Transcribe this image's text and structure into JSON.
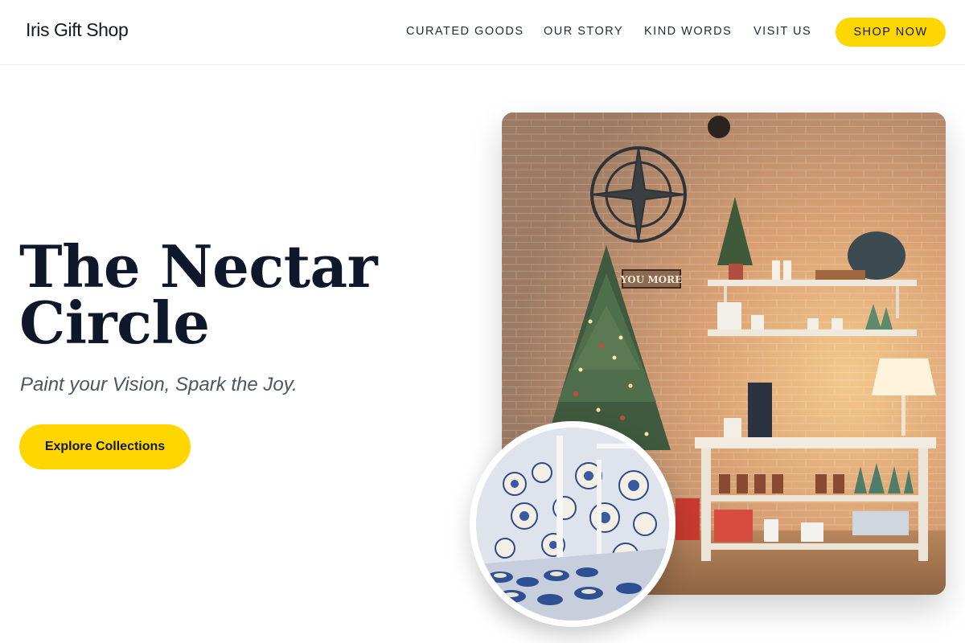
{
  "header": {
    "brand": "Iris Gift Shop",
    "nav": [
      "CURATED GOODS",
      "OUR STORY",
      "KIND WORDS",
      "VISIT US"
    ],
    "cta": "SHOP NOW"
  },
  "hero": {
    "title_line1": "The Nectar",
    "title_line2": "Circle",
    "tagline": "Paint your Vision, Spark the Joy.",
    "button": "Explore Collections"
  },
  "images": {
    "main": "shop-interior-photo",
    "circle": "pottery-shelves-photo",
    "sign_text": "YOU MORE"
  },
  "colors": {
    "accent": "#ffd600",
    "heading": "#0f172a",
    "tagline": "#4b5563"
  }
}
